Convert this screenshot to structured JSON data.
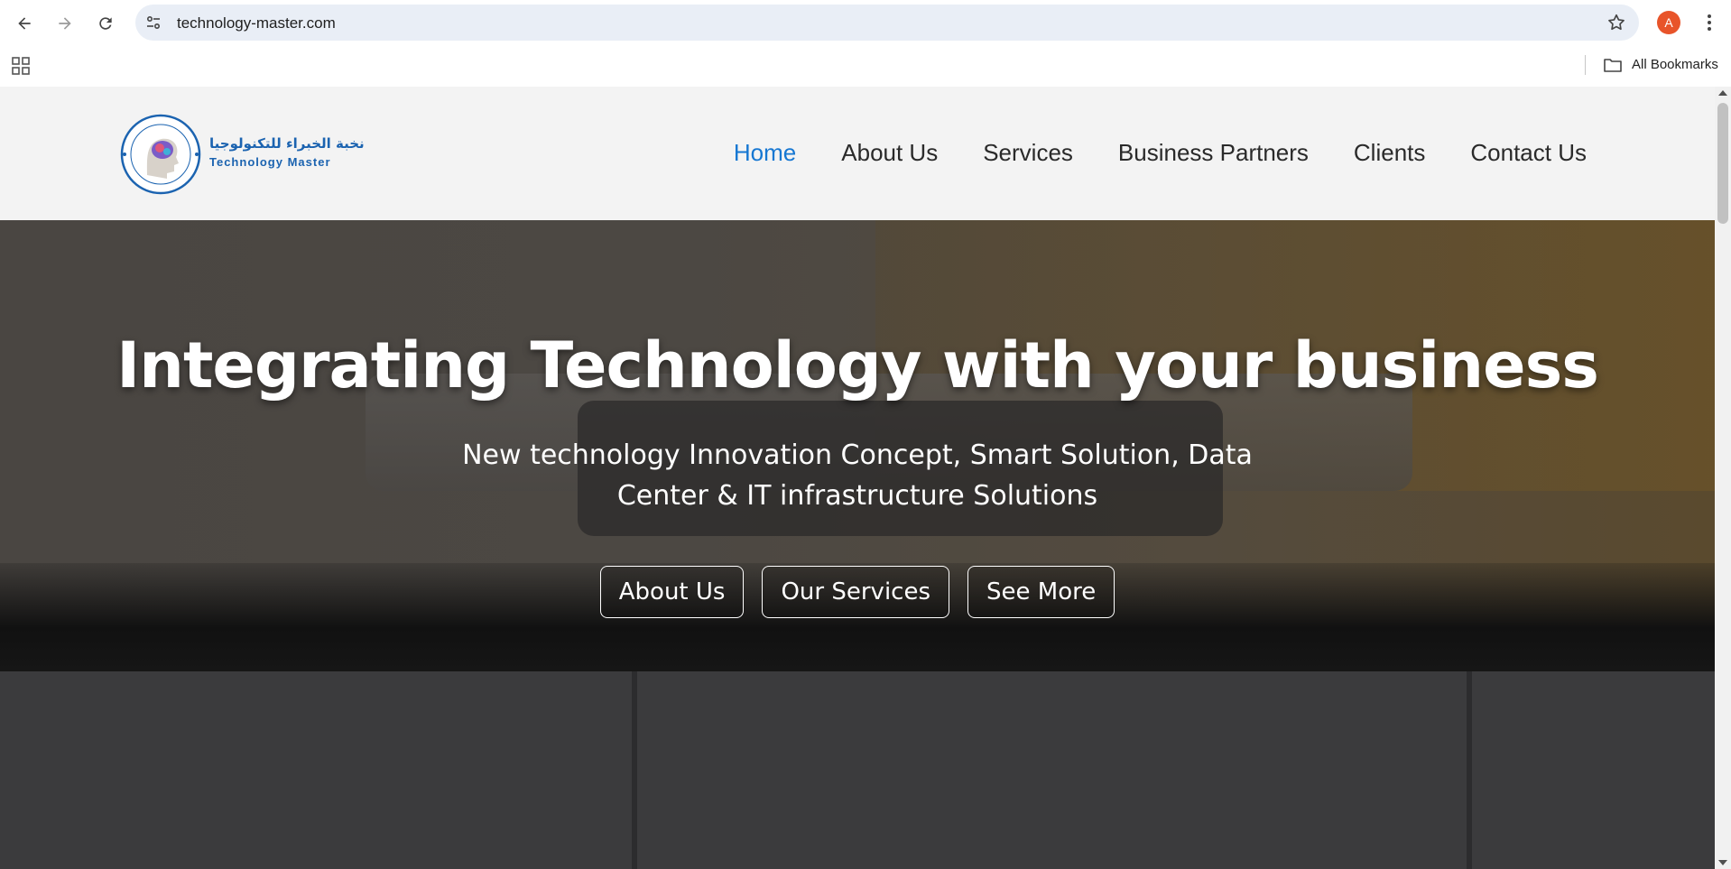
{
  "browser": {
    "url": "technology-master.com",
    "avatar_initial": "A",
    "bookmarks_label": "All Bookmarks",
    "icons": [
      "back-icon",
      "forward-icon",
      "reload-icon",
      "site-info-icon",
      "star-icon",
      "menu-dots-icon",
      "apps-icon",
      "folder-icon"
    ]
  },
  "site": {
    "logo_arabic": "نخبة الخبراء للتكنولوجيا",
    "logo_english": "Technology Master",
    "nav": [
      {
        "label": "Home",
        "active": true
      },
      {
        "label": "About Us",
        "active": false
      },
      {
        "label": "Services",
        "active": false
      },
      {
        "label": "Business Partners",
        "active": false
      },
      {
        "label": "Clients",
        "active": false
      },
      {
        "label": "Contact Us",
        "active": false
      }
    ],
    "accent_color": "#1677d2"
  },
  "hero": {
    "title": "Integrating Technology with your business",
    "subtitle": "New technology Innovation Concept, Smart Solution, Data Center & IT infrastructure Solutions",
    "buttons": [
      "About Us",
      "Our Services",
      "See More"
    ]
  }
}
